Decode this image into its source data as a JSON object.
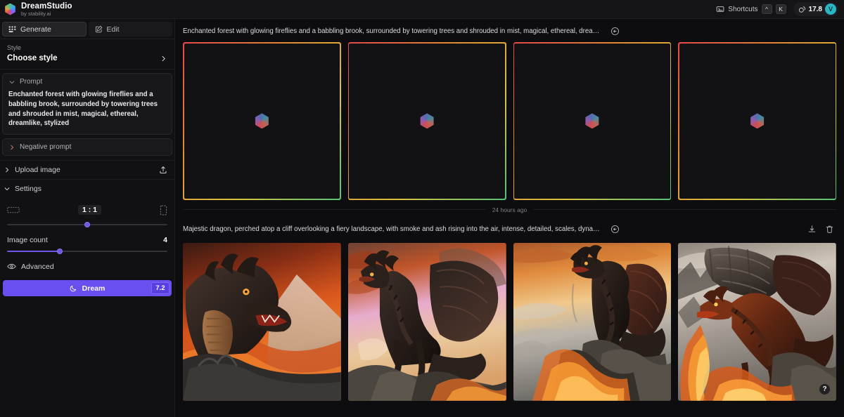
{
  "topbar": {
    "brand_title": "DreamStudio",
    "brand_subtitle": "by stability.ai",
    "shortcuts_label": "Shortcuts",
    "shortcuts_key_modifier": "^",
    "shortcuts_key": "K",
    "credits_value": "17.8",
    "avatar_initial": "V",
    "accent_color": "#6a4ff0",
    "avatar_color": "#2ab7c4"
  },
  "sidebar": {
    "tabs": [
      {
        "label": "Generate",
        "icon": "grid-icon",
        "active": true
      },
      {
        "label": "Edit",
        "icon": "pencil-square-icon",
        "active": false
      }
    ],
    "style": {
      "label": "Style",
      "value": "Choose style"
    },
    "prompt": {
      "title": "Prompt",
      "value": "Enchanted forest with glowing fireflies and a babbling brook, surrounded by towering trees and shrouded in mist, magical, ethereal, dreamlike, stylized",
      "placeholder": "Enter a prompt"
    },
    "negative_prompt": {
      "title": "Negative prompt",
      "value": "",
      "placeholder": "Negative prompt"
    },
    "upload_image": {
      "label": "Upload image"
    },
    "settings": {
      "title": "Settings",
      "aspect_ratio": {
        "value": "1 : 1",
        "slider_percent": 50,
        "left_icon": "landscape-rectangle-icon",
        "right_icon": "portrait-rectangle-icon"
      },
      "image_count": {
        "label": "Image count",
        "value": "4",
        "slider_percent": 33
      }
    },
    "advanced": {
      "label": "Advanced"
    },
    "dream_button": {
      "label": "Dream",
      "cost": "7.2"
    }
  },
  "main": {
    "generations": [
      {
        "prompt": "Enchanted forest with glowing fireflies and a babbling brook, surrounded by towering trees and shrouded in mist, magical, ethereal, dreamlik...",
        "state": "loading",
        "restore_icon": "restore-prompt-icon",
        "actions": [],
        "images": [
          {
            "alt": "loading-placeholder-1"
          },
          {
            "alt": "loading-placeholder-2"
          },
          {
            "alt": "loading-placeholder-3"
          },
          {
            "alt": "loading-placeholder-4"
          }
        ]
      },
      {
        "prompt": "Majestic dragon, perched atop a cliff overlooking a fiery landscape, with smoke and ash rising into the air, intense, detailed, scales, dynamic...",
        "state": "done",
        "restore_icon": "restore-prompt-icon",
        "actions": [
          {
            "name": "download-icon"
          },
          {
            "name": "delete-icon"
          }
        ],
        "images": [
          {
            "alt": "dragon-head-closeup-lava"
          },
          {
            "alt": "dragon-perched-cliff-river"
          },
          {
            "alt": "dragon-rearing-wings-fire"
          },
          {
            "alt": "dragon-breathing-fire-wings"
          }
        ]
      }
    ],
    "timestamp_separator": "24 hours ago",
    "help_button": "?"
  }
}
